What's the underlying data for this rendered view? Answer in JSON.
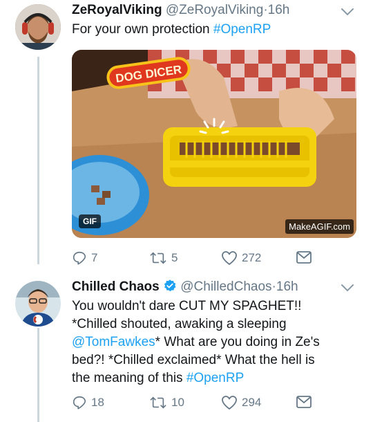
{
  "tweets": [
    {
      "name": "ZeRoyalViking",
      "handle": "@ZeRoyalViking",
      "separator": "·",
      "time": "16h",
      "text_parts": [
        "For your own protection ",
        "#OpenRP"
      ],
      "media": {
        "sign_text": "DOG DICER",
        "badge": "GIF",
        "watermark": "MakeAGIF.com"
      },
      "actions": {
        "replies": "7",
        "retweets": "5",
        "likes": "272"
      }
    },
    {
      "name": "Chilled Chaos",
      "verified": true,
      "handle": "@ChilledChaos",
      "separator": "·",
      "time": "16h",
      "lines": [
        [
          "You wouldn't dare CUT MY SPAGHET!!"
        ],
        [
          "*Chilled shouted, awaking a sleeping"
        ],
        [
          "@TomFawkes",
          "* What are you doing in Ze's"
        ],
        [
          "bed?! *Chilled exclaimed* What the hell is"
        ],
        [
          "the meaning of this ",
          "#OpenRP"
        ]
      ],
      "actions": {
        "replies": "18",
        "retweets": "10",
        "likes": "294"
      }
    }
  ],
  "colors": {
    "accent": "#1da1f2",
    "muted": "#657786",
    "thread_line": "#ccd6dd"
  }
}
